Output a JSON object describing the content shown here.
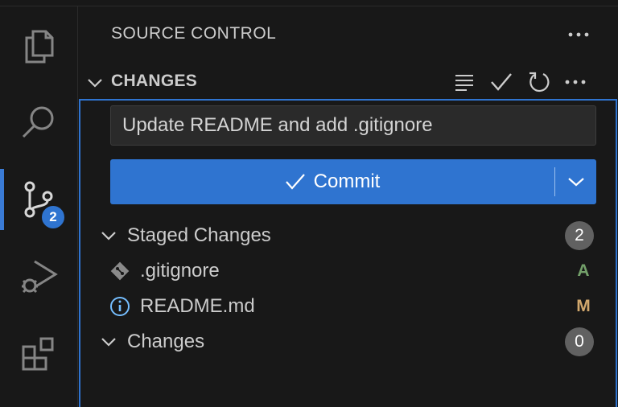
{
  "activity_bar": {
    "items": [
      {
        "name": "explorer",
        "icon": "files-icon"
      },
      {
        "name": "search",
        "icon": "search-icon"
      },
      {
        "name": "source-control",
        "icon": "source-control-icon",
        "badge": "2",
        "active": true
      },
      {
        "name": "run-and-debug",
        "icon": "run-debug-icon"
      },
      {
        "name": "extensions",
        "icon": "extensions-icon"
      }
    ]
  },
  "sidebar": {
    "title": "SOURCE CONTROL",
    "more_icon": "ellipsis-icon",
    "section": {
      "title": "CHANGES",
      "actions": [
        "view-as-tree-icon",
        "commit-check-icon",
        "refresh-icon",
        "ellipsis-icon"
      ]
    },
    "commit": {
      "message": "Update README and add .gitignore",
      "button_label": "Commit"
    },
    "staged": {
      "label": "Staged Changes",
      "count": "2",
      "files": [
        {
          "name": ".gitignore",
          "status": "A",
          "icon": "git-file-icon",
          "status_color": "#73a06a"
        },
        {
          "name": "README.md",
          "status": "M",
          "icon": "info-icon",
          "status_color": "#d2a86d"
        }
      ]
    },
    "changes": {
      "label": "Changes",
      "count": "0"
    }
  },
  "colors": {
    "accent": "#2f74d0",
    "background": "#181818",
    "badge": "#616161"
  }
}
